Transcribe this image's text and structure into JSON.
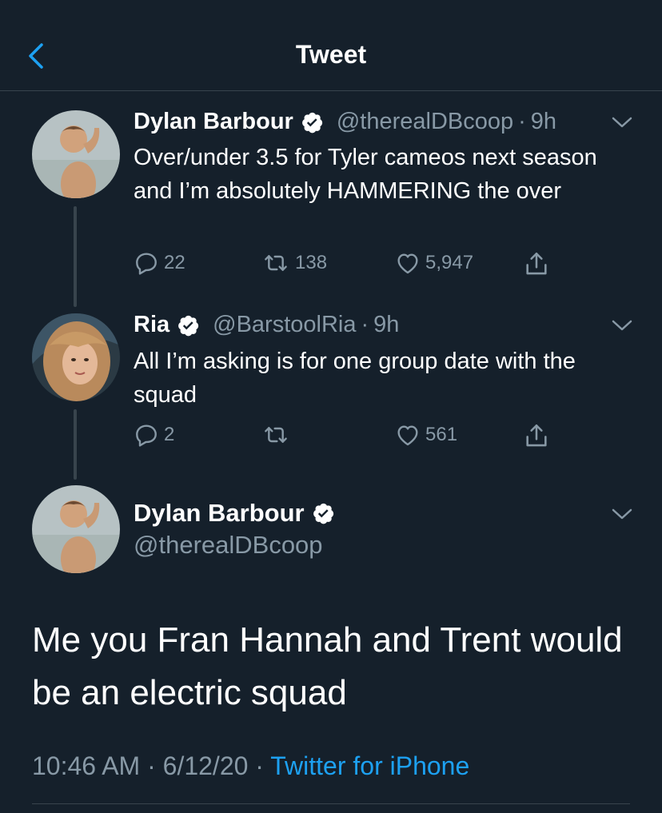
{
  "header": {
    "title": "Tweet"
  },
  "tweets": [
    {
      "name": "Dylan Barbour",
      "handle": "@therealDBcoop",
      "dot": "·",
      "time": "9h",
      "text": "Over/under 3.5 for Tyler cameos next season and I’m absolutely HAMMERING the over",
      "replies": "22",
      "retweets": "138",
      "likes": "5,947"
    },
    {
      "name": "Ria",
      "handle": "@BarstoolRia",
      "dot": "·",
      "time": "9h",
      "text": "All I’m asking is for one group date with the squad",
      "replies": "2",
      "retweets": "",
      "likes": "561"
    }
  ],
  "main_tweet": {
    "name": "Dylan Barbour",
    "handle": "@therealDBcoop",
    "text": "Me you Fran Hannah and Trent would be an electric squad",
    "time": "10:46 AM",
    "sep1": "·",
    "date": "6/12/20",
    "sep2": "·",
    "source": "Twitter for iPhone"
  },
  "icons": {
    "back": "chevron-left-icon",
    "verified": "verified-badge-icon",
    "more": "chevron-down-icon",
    "reply": "reply-icon",
    "retweet": "retweet-icon",
    "like": "heart-icon",
    "share": "share-icon"
  },
  "colors": {
    "background": "#15202b",
    "accent": "#1da1f2",
    "secondary_text": "#8899a6",
    "divider": "#38444d"
  }
}
